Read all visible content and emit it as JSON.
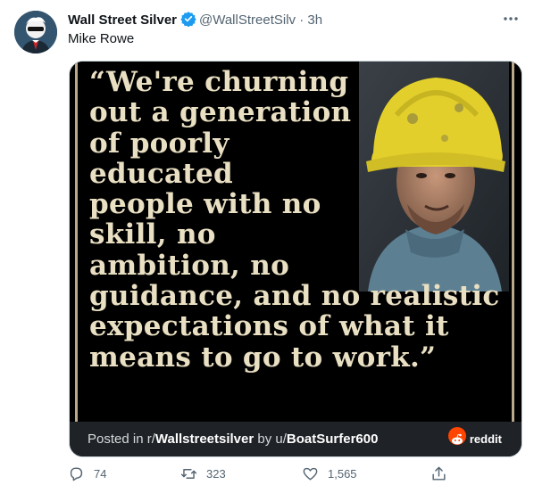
{
  "tweet": {
    "display_name": "Wall Street Silver",
    "handle": "@WallStreetSilv",
    "separator": "·",
    "time": "3h",
    "text": "Mike Rowe",
    "more_icon": "more-dots-icon"
  },
  "media": {
    "quote_lines": [
      "“We're churning",
      "out a generation",
      "of poorly",
      "educated",
      "people with no",
      "skill, no",
      "ambition, no",
      "guidance, and no realistic",
      "expectations of what it",
      "means to go to work.”"
    ],
    "footer": {
      "prefix": "Posted in r/",
      "subreddit": "Wallstreetsilver",
      "by": " by u/",
      "user": "BoatSurfer600",
      "brand": "reddit"
    }
  },
  "actions": {
    "replies": "74",
    "retweets": "323",
    "likes": "1,565"
  },
  "colors": {
    "verified": "#1d9bf0",
    "muted": "#536471",
    "quote_text": "#e9dfc2",
    "reddit": "#ff4500"
  }
}
